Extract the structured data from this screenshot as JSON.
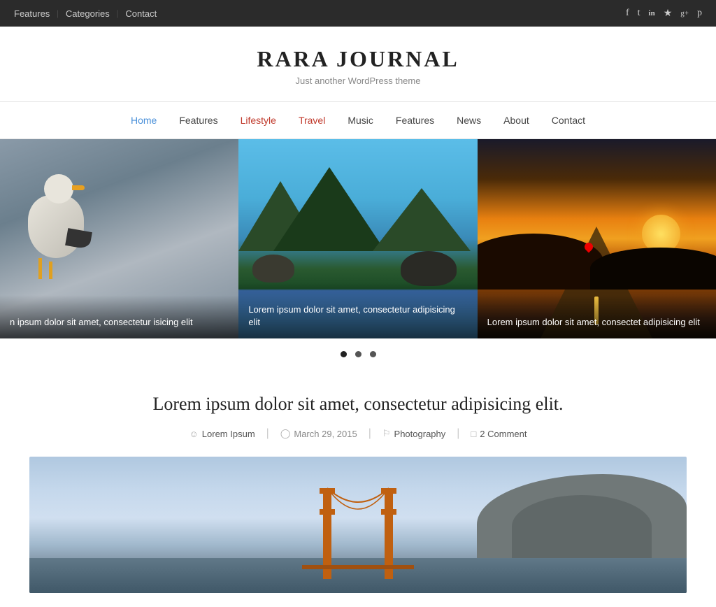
{
  "topbar": {
    "nav": [
      {
        "label": "Features",
        "href": "#"
      },
      {
        "label": "Categories",
        "href": "#"
      },
      {
        "label": "Contact",
        "href": "#"
      }
    ],
    "social": [
      {
        "name": "facebook-icon",
        "glyph": "f"
      },
      {
        "name": "twitter-icon",
        "glyph": "t"
      },
      {
        "name": "linkedin-icon",
        "glyph": "in"
      },
      {
        "name": "rss-icon",
        "glyph": "rss"
      },
      {
        "name": "googleplus-icon",
        "glyph": "g+"
      },
      {
        "name": "pinterest-icon",
        "glyph": "p"
      }
    ]
  },
  "header": {
    "title": "RARA JOURNAL",
    "tagline": "Just another WordPress theme"
  },
  "mainnav": {
    "items": [
      {
        "label": "Home",
        "active": true
      },
      {
        "label": "Features",
        "active": false
      },
      {
        "label": "Lifestyle",
        "active": false
      },
      {
        "label": "Travel",
        "active": false
      },
      {
        "label": "Music",
        "active": false
      },
      {
        "label": "Features",
        "active": false
      },
      {
        "label": "News",
        "active": false
      },
      {
        "label": "About",
        "active": false
      },
      {
        "label": "Contact",
        "active": false
      }
    ]
  },
  "slider": {
    "slides": [
      {
        "caption": "n ipsum dolor sit amet, consectetur\nisicing elit"
      },
      {
        "caption": "Lorem ipsum dolor sit amet, consectetur\nadipisicing elit"
      },
      {
        "caption": "Lorem ipsum dolor sit amet, consectet\nadipisicing elit"
      }
    ],
    "dots": [
      {
        "active": true
      },
      {
        "active": false
      },
      {
        "active": false
      }
    ]
  },
  "post": {
    "title": "Lorem ipsum dolor sit amet, consectetur adipisicing elit.",
    "author": "Lorem Ipsum",
    "date": "March 29, 2015",
    "category": "Photography",
    "comments": "2 Comment"
  }
}
